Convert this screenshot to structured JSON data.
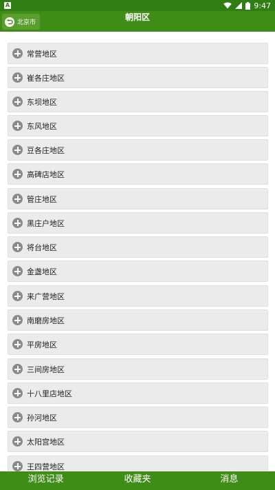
{
  "status_bar": {
    "left_icon": "A",
    "time": "9:47",
    "icons": [
      "wifi-icon",
      "signal-icon",
      "battery-icon"
    ]
  },
  "header": {
    "back_label": "北京市",
    "title": "朝阳区"
  },
  "list": {
    "items": [
      {
        "label": "常营地区"
      },
      {
        "label": "崔各庄地区"
      },
      {
        "label": "东坝地区"
      },
      {
        "label": "东风地区"
      },
      {
        "label": "豆各庄地区"
      },
      {
        "label": "高碑店地区"
      },
      {
        "label": "管庄地区"
      },
      {
        "label": "黑庄户地区"
      },
      {
        "label": "将台地区"
      },
      {
        "label": "金盏地区"
      },
      {
        "label": "来广营地区"
      },
      {
        "label": "南磨房地区"
      },
      {
        "label": "平房地区"
      },
      {
        "label": "三间房地区"
      },
      {
        "label": "十八里店地区"
      },
      {
        "label": "孙河地区"
      },
      {
        "label": "太阳宫地区"
      },
      {
        "label": "王四营地区"
      }
    ]
  },
  "bottom_nav": {
    "tabs": [
      {
        "label": "浏览记录"
      },
      {
        "label": "收藏夹"
      },
      {
        "label": "消息"
      }
    ]
  },
  "colors": {
    "status_bar": "#2f7d13",
    "app_bar": "#3f8d18",
    "item_bg": "#ebebeb"
  }
}
